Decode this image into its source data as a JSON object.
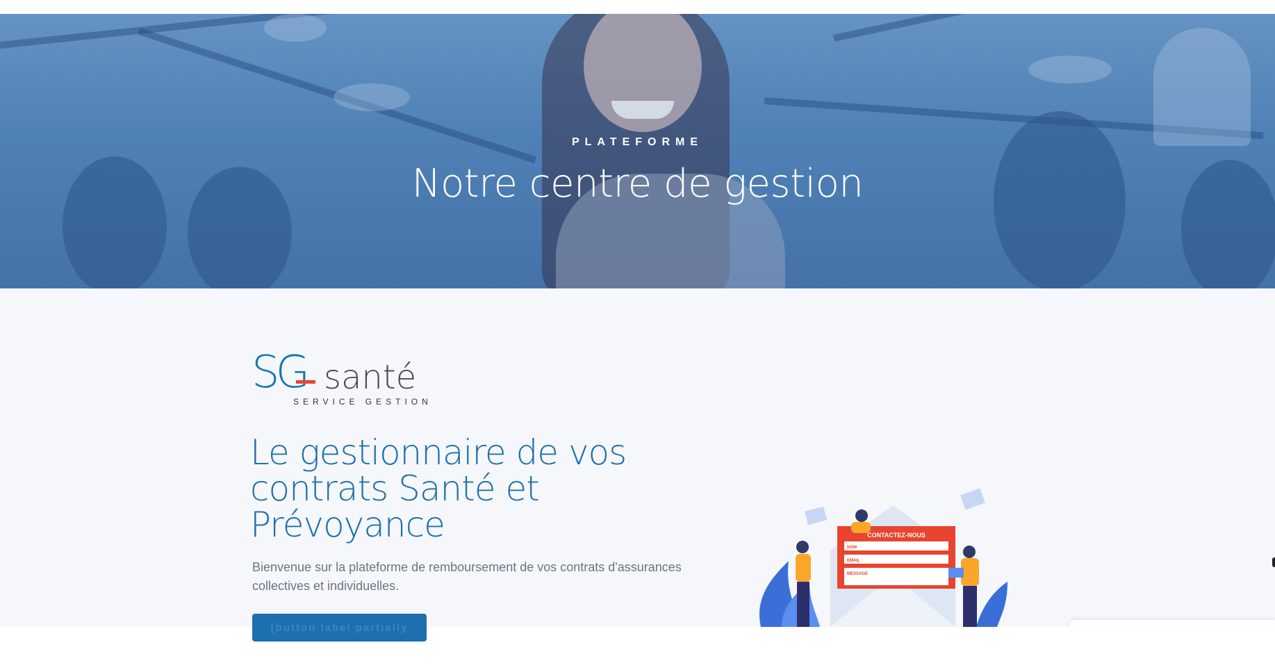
{
  "hero": {
    "eyebrow": "PLATEFORME",
    "title": "Notre centre de gestion"
  },
  "brand": {
    "logo_sg": "SG",
    "logo_sante": "santé",
    "logo_tagline": "SERVICE GESTION"
  },
  "main": {
    "headline": "Le gestionnaire de vos contrats Santé et Prévoyance",
    "intro": "Bienvenue sur la plateforme de remboursement de vos contrats d'assurances collectives et individuelles.",
    "cta_label": "[button label partially hidden by bottom edge]"
  },
  "illustration": {
    "form_title": "CONTACTEZ-NOUS",
    "field_nom": "NOM",
    "field_email": "EMAIL",
    "field_message": "MESSAGE"
  },
  "colors": {
    "primary": "#1d6fae",
    "accent_red": "#e8442f",
    "background": "#f5f7fa"
  }
}
